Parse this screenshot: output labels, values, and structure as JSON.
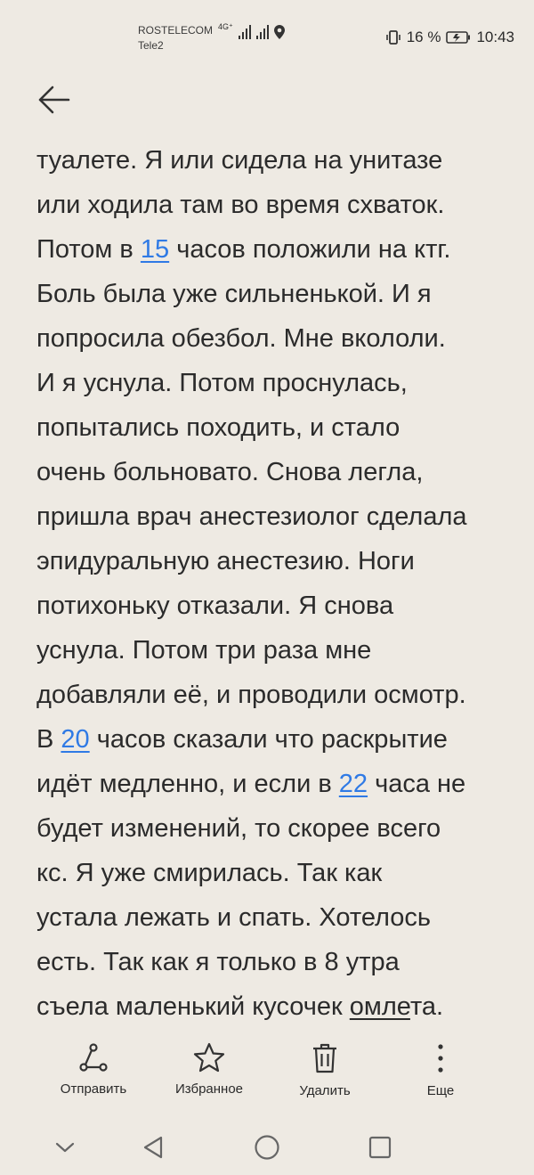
{
  "status_bar": {
    "carrier1": "ROSTELECOM",
    "carrier2": "Tele2",
    "network": "4G⁺",
    "battery": "16 %",
    "time": "10:43"
  },
  "content": {
    "lines": [
      [
        "туалете. Я или сидела на унитазе"
      ],
      [
        "или ходила там во время схваток."
      ],
      [
        "Потом в ",
        {
          "link": "15"
        },
        " часов положили на ктг."
      ],
      [
        "Боль была уже сильненькой. И я"
      ],
      [
        "попросила обезбол. Мне вкололи."
      ],
      [
        "И я уснула. Потом проснулась,"
      ],
      [
        "попытались походить, и стало"
      ],
      [
        "очень больновато. Снова легла,"
      ],
      [
        "пришла врач анестезиолог сделала"
      ],
      [
        "эпидуральную анестезию. Ноги"
      ],
      [
        "потихоньку отказали. Я снова"
      ],
      [
        "уснула. Потом три раза мне"
      ],
      [
        "добавляли её, и проводили осмотр."
      ],
      [
        "В ",
        {
          "link": "20"
        },
        " часов сказали что раскрытие"
      ],
      [
        "идёт медленно, и если в ",
        {
          "link": "22"
        },
        " часа не"
      ],
      [
        "будет изменений, то скорее всего"
      ],
      [
        "кс. Я уже смирилась. Так как"
      ],
      [
        "устала лежать и спать. Хотелось"
      ],
      [
        "есть. Так как я только в 8 утра"
      ],
      [
        "съела маленький кусочек ",
        {
          "u": "омле"
        },
        "та."
      ]
    ]
  },
  "toolbar": {
    "send": "Отправить",
    "favorites": "Избранное",
    "delete": "Удалить",
    "more": "Еще"
  }
}
